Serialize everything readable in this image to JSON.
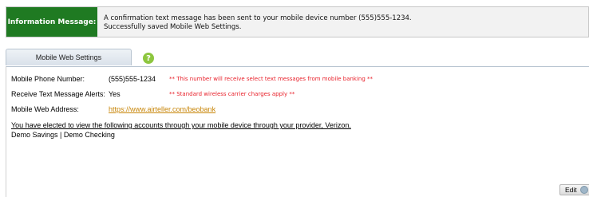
{
  "info": {
    "label": "Information Message:",
    "line1": "A confirmation text message has been sent to your mobile device number (555)555-1234.",
    "line2": "Successfully saved Mobile Web Settings."
  },
  "tabs": [
    {
      "label": "Mobile Web Settings",
      "selected": true
    }
  ],
  "help_icon": "help-icon",
  "settings": {
    "phone_label": "Mobile Phone Number:",
    "phone_value": "(555)555-1234",
    "phone_note": "** This number will receive select text messages from mobile banking **",
    "alerts_label": "Receive Text Message Alerts:",
    "alerts_value": "Yes",
    "alerts_note": "** Standard wireless carrier charges apply **",
    "address_label": "Mobile Web Address:",
    "address_value": "https://www.airteller.com/beobank"
  },
  "statement": "You have elected to view the following accounts through your mobile device through your provider, Verizon.",
  "accounts": "Demo Savings | Demo Checking",
  "edit_button": {
    "label": "Edit",
    "icon": "edit-icon"
  },
  "colors": {
    "info_accent": "#1f7a22",
    "note_red": "#e8202a",
    "link": "#c8860a",
    "help": "#8dc63f"
  }
}
